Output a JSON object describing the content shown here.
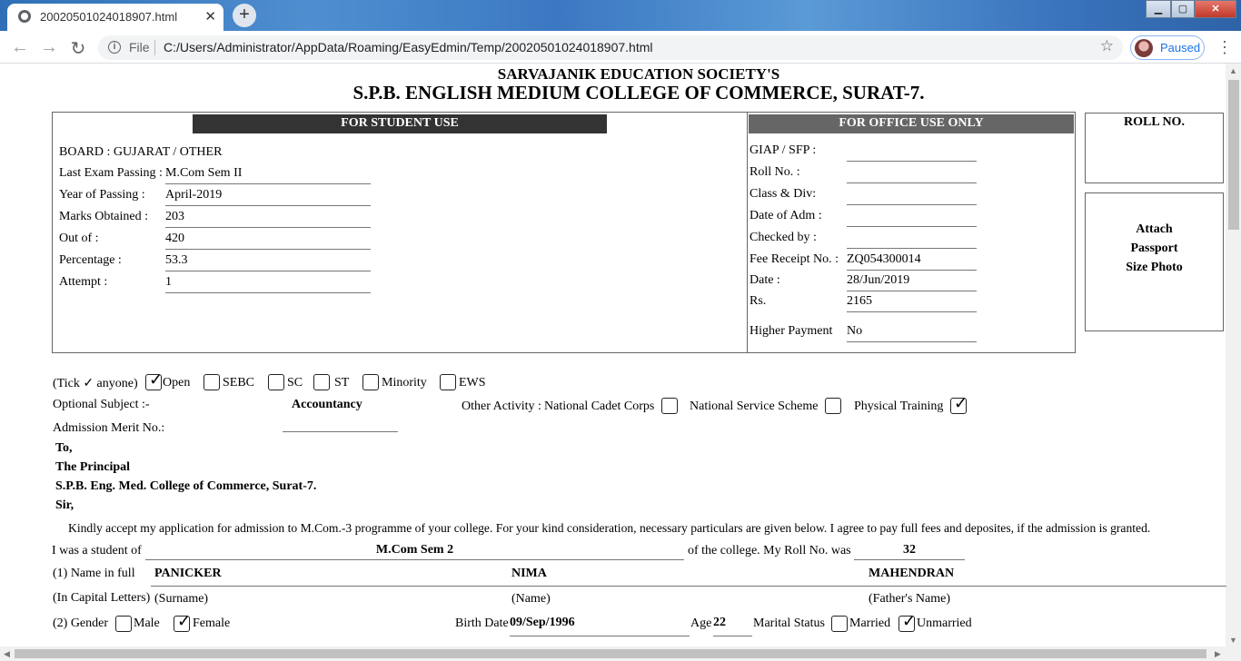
{
  "browser": {
    "tab_title": "20020501024018907.html",
    "tab_close": "✕",
    "new_tab": "+",
    "address_prefix": "File",
    "address_url": "C:/Users/Administrator/AppData/Roaming/EasyEdmin/Temp/20020501024018907.html",
    "profile_status": "Paused",
    "accent_color": "#1a73e8"
  },
  "header": {
    "society": "SARVAJANIK EDUCATION SOCIETY'S",
    "college": "S.P.B. ENGLISH MEDIUM COLLEGE OF COMMERCE, SURAT-7."
  },
  "student_use": {
    "heading": "FOR STUDENT USE",
    "board": "BOARD : GUJARAT / OTHER",
    "fields": [
      {
        "label": "Last Exam Passing :",
        "value": "M.Com Sem II"
      },
      {
        "label": "Year of Passing :",
        "value": "April-2019"
      },
      {
        "label": "Marks Obtained :",
        "value": "203"
      },
      {
        "label": "Out of :",
        "value": "420"
      },
      {
        "label": "Percentage :",
        "value": "53.3"
      },
      {
        "label": "Attempt :",
        "value": "1"
      }
    ]
  },
  "office_use": {
    "heading": "FOR OFFICE USE ONLY",
    "fields": [
      {
        "label": "GIAP / SFP :",
        "value": ""
      },
      {
        "label": "Roll No. :",
        "value": ""
      },
      {
        "label": "Class & Div:",
        "value": ""
      },
      {
        "label": "Date of Adm :",
        "value": ""
      },
      {
        "label": "Checked by :",
        "value": ""
      },
      {
        "label": "Fee Receipt No. :",
        "value": "ZQ054300014"
      },
      {
        "label": "Date :",
        "value": "28/Jun/2019"
      },
      {
        "label": "Rs.",
        "value": "2165"
      },
      {
        "label": "Higher Payment",
        "value": "No"
      }
    ]
  },
  "roll_box": {
    "label": "ROLL NO."
  },
  "photo_box": {
    "line1": "Attach",
    "line2": "Passport",
    "line3": "Size Photo"
  },
  "category": {
    "prefix": "(Tick ✓ anyone)",
    "options": [
      {
        "label": "Open",
        "checked": true
      },
      {
        "label": "SEBC",
        "checked": false
      },
      {
        "label": "SC",
        "checked": false
      },
      {
        "label": "ST",
        "checked": false
      },
      {
        "label": "Minority",
        "checked": false
      },
      {
        "label": "EWS",
        "checked": false
      }
    ]
  },
  "optional_subject": {
    "label": "Optional Subject :-",
    "value": "Accountancy"
  },
  "other_activity": {
    "label": "Other Activity :",
    "options": [
      {
        "label": "National Cadet Corps",
        "checked": false
      },
      {
        "label": "National Service Scheme",
        "checked": false
      },
      {
        "label": "Physical Training",
        "checked": true
      }
    ]
  },
  "merit": {
    "label": "Admission Merit No.:",
    "value": ""
  },
  "address": {
    "to": "To,",
    "principal": "The Principal",
    "college": "S.P.B. Eng. Med. College of Commerce, Surat-7.",
    "sir": "Sir,"
  },
  "body_text": "Kindly accept my application for admission to M.Com.-3 programme of your college. For your kind consideration, necessary particulars are given below. I agree to pay full fees and deposites, if the admission is granted.",
  "student_line": {
    "label": "I was a student of",
    "value": "M.Com Sem 2",
    "mid": "of the college. My Roll No. was",
    "roll": "32"
  },
  "name": {
    "label": "(1) Name in full",
    "surname": "PANICKER",
    "first": "NIMA",
    "father": "MAHENDRAN",
    "caption_label": "(In Capital Letters)",
    "surname_caption": "(Surname)",
    "first_caption": "(Name)",
    "father_caption": "(Father's Name)"
  },
  "gender": {
    "label": "(2) Gender",
    "options": [
      {
        "label": "Male",
        "checked": false
      },
      {
        "label": "Female",
        "checked": true
      }
    ],
    "birth_label": "Birth Date",
    "birth_value": "09/Sep/1996",
    "age_label": "Age",
    "age_value": "22",
    "marital_label": "Marital Status",
    "marital_options": [
      {
        "label": "Married",
        "checked": false
      },
      {
        "label": "Unmarried",
        "checked": true
      }
    ]
  }
}
